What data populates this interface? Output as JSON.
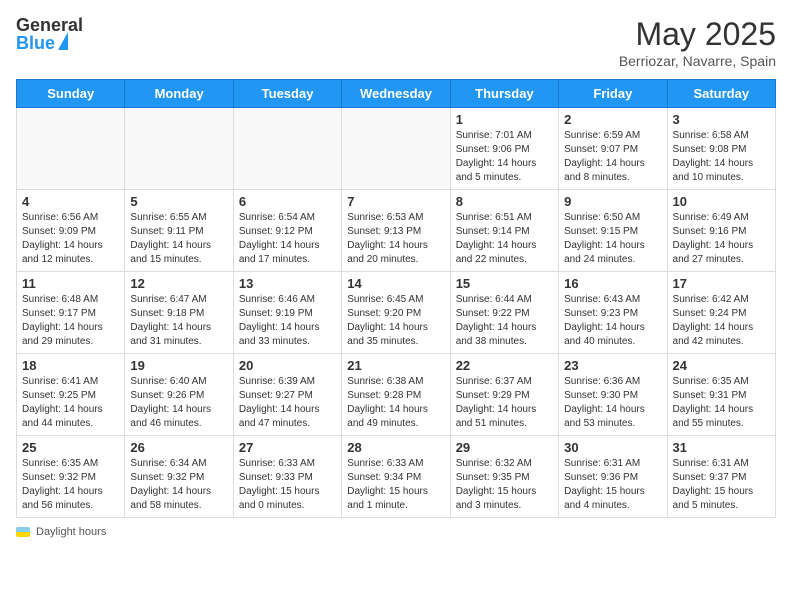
{
  "header": {
    "logo_general": "General",
    "logo_blue": "Blue",
    "month_title": "May 2025",
    "location": "Berriozar, Navarre, Spain"
  },
  "footer": {
    "label": "Daylight hours"
  },
  "days_of_week": [
    "Sunday",
    "Monday",
    "Tuesday",
    "Wednesday",
    "Thursday",
    "Friday",
    "Saturday"
  ],
  "weeks": [
    [
      {
        "day": "",
        "info": ""
      },
      {
        "day": "",
        "info": ""
      },
      {
        "day": "",
        "info": ""
      },
      {
        "day": "",
        "info": ""
      },
      {
        "day": "1",
        "info": "Sunrise: 7:01 AM\nSunset: 9:06 PM\nDaylight: 14 hours\nand 5 minutes."
      },
      {
        "day": "2",
        "info": "Sunrise: 6:59 AM\nSunset: 9:07 PM\nDaylight: 14 hours\nand 8 minutes."
      },
      {
        "day": "3",
        "info": "Sunrise: 6:58 AM\nSunset: 9:08 PM\nDaylight: 14 hours\nand 10 minutes."
      }
    ],
    [
      {
        "day": "4",
        "info": "Sunrise: 6:56 AM\nSunset: 9:09 PM\nDaylight: 14 hours\nand 12 minutes."
      },
      {
        "day": "5",
        "info": "Sunrise: 6:55 AM\nSunset: 9:11 PM\nDaylight: 14 hours\nand 15 minutes."
      },
      {
        "day": "6",
        "info": "Sunrise: 6:54 AM\nSunset: 9:12 PM\nDaylight: 14 hours\nand 17 minutes."
      },
      {
        "day": "7",
        "info": "Sunrise: 6:53 AM\nSunset: 9:13 PM\nDaylight: 14 hours\nand 20 minutes."
      },
      {
        "day": "8",
        "info": "Sunrise: 6:51 AM\nSunset: 9:14 PM\nDaylight: 14 hours\nand 22 minutes."
      },
      {
        "day": "9",
        "info": "Sunrise: 6:50 AM\nSunset: 9:15 PM\nDaylight: 14 hours\nand 24 minutes."
      },
      {
        "day": "10",
        "info": "Sunrise: 6:49 AM\nSunset: 9:16 PM\nDaylight: 14 hours\nand 27 minutes."
      }
    ],
    [
      {
        "day": "11",
        "info": "Sunrise: 6:48 AM\nSunset: 9:17 PM\nDaylight: 14 hours\nand 29 minutes."
      },
      {
        "day": "12",
        "info": "Sunrise: 6:47 AM\nSunset: 9:18 PM\nDaylight: 14 hours\nand 31 minutes."
      },
      {
        "day": "13",
        "info": "Sunrise: 6:46 AM\nSunset: 9:19 PM\nDaylight: 14 hours\nand 33 minutes."
      },
      {
        "day": "14",
        "info": "Sunrise: 6:45 AM\nSunset: 9:20 PM\nDaylight: 14 hours\nand 35 minutes."
      },
      {
        "day": "15",
        "info": "Sunrise: 6:44 AM\nSunset: 9:22 PM\nDaylight: 14 hours\nand 38 minutes."
      },
      {
        "day": "16",
        "info": "Sunrise: 6:43 AM\nSunset: 9:23 PM\nDaylight: 14 hours\nand 40 minutes."
      },
      {
        "day": "17",
        "info": "Sunrise: 6:42 AM\nSunset: 9:24 PM\nDaylight: 14 hours\nand 42 minutes."
      }
    ],
    [
      {
        "day": "18",
        "info": "Sunrise: 6:41 AM\nSunset: 9:25 PM\nDaylight: 14 hours\nand 44 minutes."
      },
      {
        "day": "19",
        "info": "Sunrise: 6:40 AM\nSunset: 9:26 PM\nDaylight: 14 hours\nand 46 minutes."
      },
      {
        "day": "20",
        "info": "Sunrise: 6:39 AM\nSunset: 9:27 PM\nDaylight: 14 hours\nand 47 minutes."
      },
      {
        "day": "21",
        "info": "Sunrise: 6:38 AM\nSunset: 9:28 PM\nDaylight: 14 hours\nand 49 minutes."
      },
      {
        "day": "22",
        "info": "Sunrise: 6:37 AM\nSunset: 9:29 PM\nDaylight: 14 hours\nand 51 minutes."
      },
      {
        "day": "23",
        "info": "Sunrise: 6:36 AM\nSunset: 9:30 PM\nDaylight: 14 hours\nand 53 minutes."
      },
      {
        "day": "24",
        "info": "Sunrise: 6:35 AM\nSunset: 9:31 PM\nDaylight: 14 hours\nand 55 minutes."
      }
    ],
    [
      {
        "day": "25",
        "info": "Sunrise: 6:35 AM\nSunset: 9:32 PM\nDaylight: 14 hours\nand 56 minutes."
      },
      {
        "day": "26",
        "info": "Sunrise: 6:34 AM\nSunset: 9:32 PM\nDaylight: 14 hours\nand 58 minutes."
      },
      {
        "day": "27",
        "info": "Sunrise: 6:33 AM\nSunset: 9:33 PM\nDaylight: 15 hours\nand 0 minutes."
      },
      {
        "day": "28",
        "info": "Sunrise: 6:33 AM\nSunset: 9:34 PM\nDaylight: 15 hours\nand 1 minute."
      },
      {
        "day": "29",
        "info": "Sunrise: 6:32 AM\nSunset: 9:35 PM\nDaylight: 15 hours\nand 3 minutes."
      },
      {
        "day": "30",
        "info": "Sunrise: 6:31 AM\nSunset: 9:36 PM\nDaylight: 15 hours\nand 4 minutes."
      },
      {
        "day": "31",
        "info": "Sunrise: 6:31 AM\nSunset: 9:37 PM\nDaylight: 15 hours\nand 5 minutes."
      }
    ]
  ]
}
